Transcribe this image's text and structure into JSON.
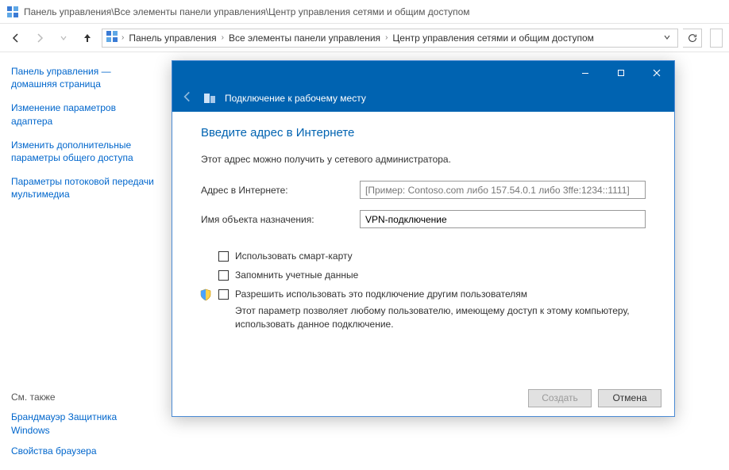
{
  "window": {
    "title_path": "Панель управления\\Все элементы панели управления\\Центр управления сетями и общим доступом"
  },
  "breadcrumb": {
    "items": [
      "Панель управления",
      "Все элементы панели управления",
      "Центр управления сетями и общим доступом"
    ]
  },
  "sidebar": {
    "home_label": "Панель управления — домашняя страница",
    "links": [
      "Изменение параметров адаптера",
      "Изменить дополнительные параметры общего доступа",
      "Параметры потоковой передачи мультимедиа"
    ],
    "see_also_label": "См. также",
    "see_also_links": [
      "Брандмауэр Защитника Windows",
      "Свойства браузера"
    ]
  },
  "dialog": {
    "header_title": "Подключение к рабочему месту",
    "heading": "Введите адрес в Интернете",
    "subtext": "Этот адрес можно получить у сетевого администратора.",
    "addr_label": "Адрес в Интернете:",
    "addr_placeholder": "[Пример: Contoso.com либо 157.54.0.1 либо 3ffe:1234::1111]",
    "dest_label": "Имя объекта назначения:",
    "dest_value": "VPN-подключение",
    "check_smartcard": "Использовать смарт-карту",
    "check_remember": "Запомнить учетные данные",
    "check_allow": "Разрешить использовать это подключение другим пользователям",
    "allow_desc": "Этот параметр позволяет любому пользователю, имеющему доступ к этому компьютеру, использовать данное подключение.",
    "btn_create": "Создать",
    "btn_cancel": "Отмена"
  }
}
